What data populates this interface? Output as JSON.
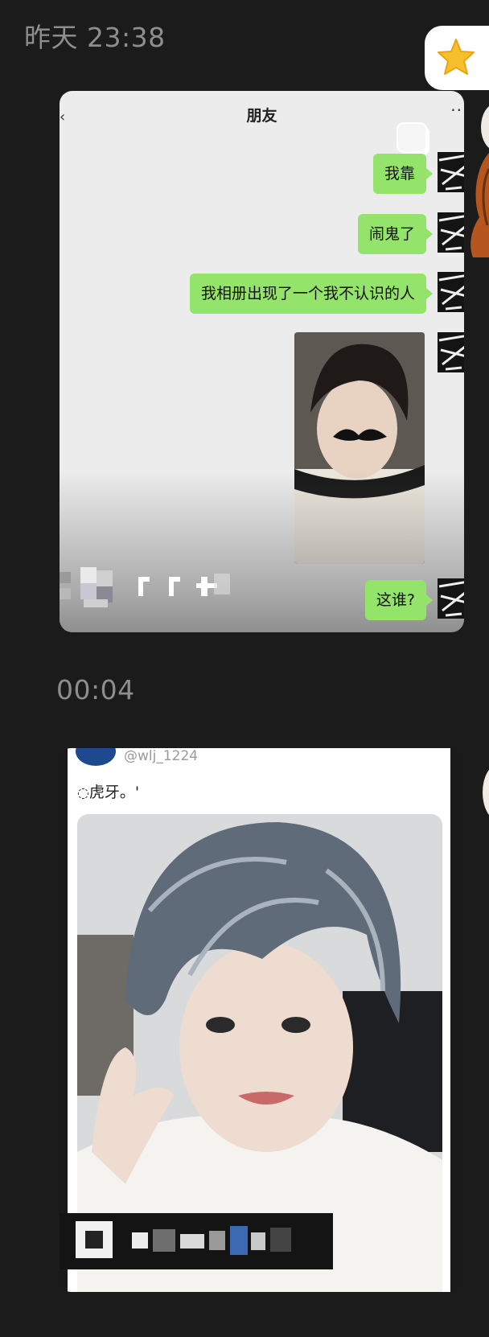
{
  "timestamps": {
    "first": "昨天 23:38",
    "second": "00:04"
  },
  "chat_card": {
    "title": "朋友",
    "messages": [
      {
        "text": "我靠"
      },
      {
        "text": "闹鬼了"
      },
      {
        "text": "我相册出现了一个我不认识的人"
      },
      {
        "text": "这谁?"
      }
    ]
  },
  "post_card": {
    "handle": "@wlj_1224",
    "caption": "虎牙。'"
  },
  "colors": {
    "background": "#1b1b1b",
    "bubble_green": "#94e36a",
    "timestamp_gray": "#8e8e8e"
  }
}
